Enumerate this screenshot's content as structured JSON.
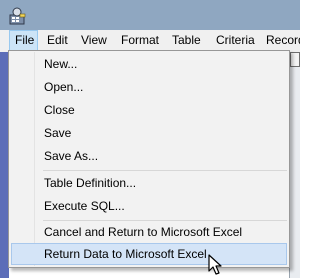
{
  "menubar": {
    "items": [
      "File",
      "Edit",
      "View",
      "Format",
      "Table",
      "Criteria",
      "Records"
    ],
    "active": "File"
  },
  "dropdown": {
    "items": [
      {
        "label": "New..."
      },
      {
        "label": "Open..."
      },
      {
        "label": "Close"
      },
      {
        "label": "Save"
      },
      {
        "label": "Save As..."
      },
      {
        "label": "Table Definition..."
      },
      {
        "label": "Execute SQL..."
      },
      {
        "label": "Cancel and Return to Microsoft Excel"
      },
      {
        "label": "Return Data to Microsoft Excel",
        "highlighted": true
      }
    ]
  },
  "icons": {
    "app": "query-app-icon",
    "cursor": "mouse-pointer-icon"
  },
  "colors": {
    "titlebar": "#8fa7c1",
    "menu_bg": "#f0f0f0",
    "menu_active": "#cce4f7",
    "item_highlight": "#d4e4f7"
  }
}
